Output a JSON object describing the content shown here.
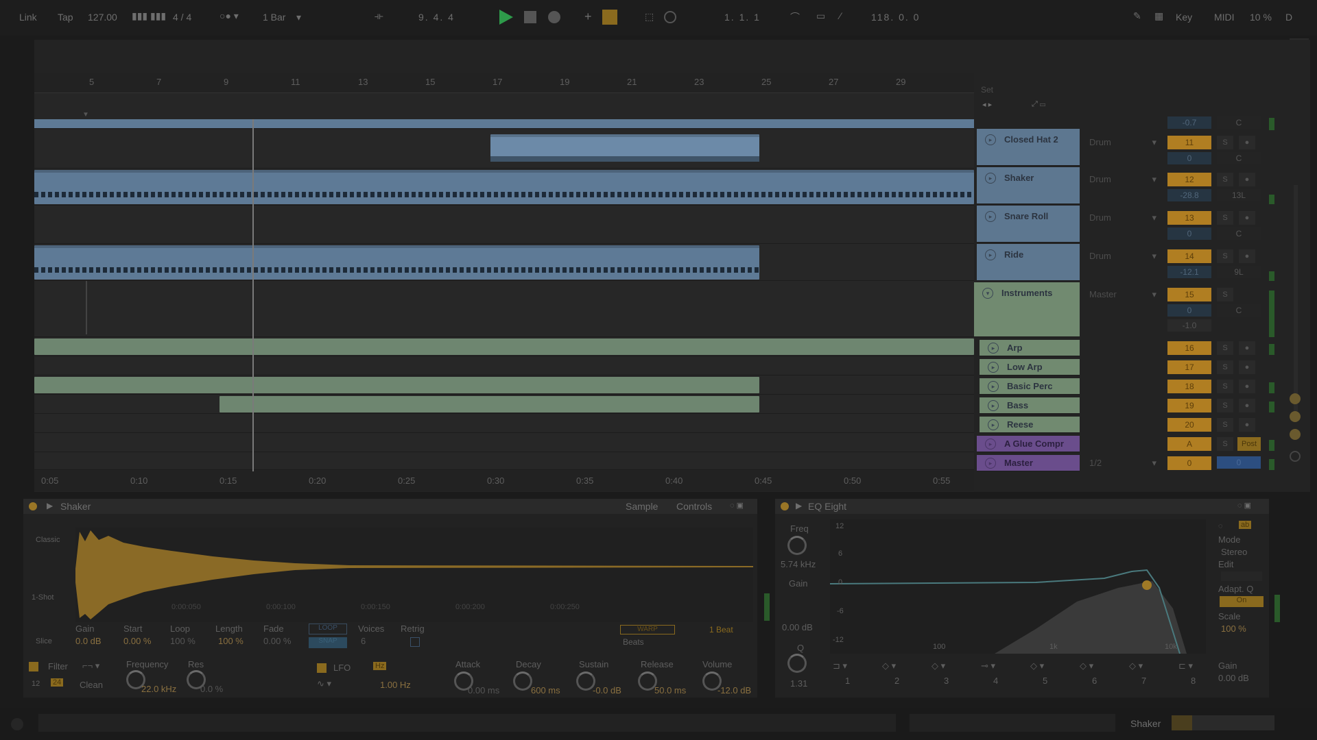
{
  "transport": {
    "link": "Link",
    "tap": "Tap",
    "tempo": "127.00",
    "signature": "4 / 4",
    "quantize": "1 Bar",
    "position": "9.   4.   4",
    "loop_start": "1.   1.   1",
    "loop_length": "118.   0.   0",
    "key": "Key",
    "midi": "MIDI",
    "cpu": "10 %",
    "d": "D"
  },
  "ruler": {
    "bars": [
      "5",
      "7",
      "9",
      "11",
      "13",
      "15",
      "17",
      "19",
      "21",
      "23",
      "25",
      "27",
      "29"
    ],
    "times": [
      "0:05",
      "0:10",
      "0:15",
      "0:20",
      "0:25",
      "0:30",
      "0:35",
      "0:40",
      "0:45",
      "0:50",
      "0:55"
    ]
  },
  "set_label": "Set",
  "tracks": [
    {
      "name": "Closed Hat 2",
      "route": "Drum",
      "num": "11",
      "vol": "0",
      "pan": "C",
      "color": "blue"
    },
    {
      "name": "Shaker",
      "route": "Drum",
      "num": "12",
      "vol": "-28.8",
      "pan": "13L",
      "color": "blue"
    },
    {
      "name": "Snare Roll",
      "route": "Drum",
      "num": "13",
      "vol": "0",
      "pan": "C",
      "color": "blue"
    },
    {
      "name": "Ride",
      "route": "Drum",
      "num": "14",
      "vol": "-12.1",
      "pan": "9L",
      "color": "blue"
    },
    {
      "name": "Instruments",
      "route": "Master",
      "num": "15",
      "vol": "0",
      "pan": "C",
      "extra": "-1.0",
      "color": "green"
    },
    {
      "name": "Arp",
      "num": "16",
      "color": "green"
    },
    {
      "name": "Low Arp",
      "num": "17",
      "color": "green"
    },
    {
      "name": "Basic Perc",
      "num": "18",
      "color": "green"
    },
    {
      "name": "Bass",
      "num": "19",
      "color": "green"
    },
    {
      "name": "Reese",
      "num": "20",
      "color": "green"
    },
    {
      "name": "A Glue Compr",
      "num": "A",
      "extra": "Post",
      "color": "purple"
    },
    {
      "name": "Master",
      "route": "1/2",
      "num": "0",
      "vol": "0",
      "color": "purple"
    }
  ],
  "top_values": {
    "vol": "-0.7",
    "pan": "C"
  },
  "sampler": {
    "title": "Shaker",
    "tab_sample": "Sample",
    "tab_controls": "Controls",
    "mode": "Classic",
    "one_shot": "1-Shot",
    "slice": "Slice",
    "ticks": [
      "0:00:050",
      "0:00:100",
      "0:00:150",
      "0:00:200",
      "0:00:250"
    ],
    "gain_lbl": "Gain",
    "gain": "0.0 dB",
    "start_lbl": "Start",
    "start": "0.00 %",
    "loop_lbl": "Loop",
    "loop": "100 %",
    "length_lbl": "Length",
    "length": "100 %",
    "fade_lbl": "Fade",
    "fade": "0.00 %",
    "loop_btn": "LOOP",
    "snap_btn": "SNAP",
    "voices_lbl": "Voices",
    "voices": "6",
    "retrig_lbl": "Retrig",
    "warp_btn": "WARP",
    "beats_lbl": "Beats",
    "beat_val": "1 Beat",
    "filter_lbl": "Filter",
    "filter_type": "Clean",
    "f12": "12",
    "f24": "24",
    "freq_lbl": "Frequency",
    "freq": "22.0 kHz",
    "res_lbl": "Res",
    "res": "0.0 %",
    "lfo_lbl": "LFO",
    "lfo_hz": "Hz",
    "lfo_rate": "1.00 Hz",
    "attack_lbl": "Attack",
    "attack": "0.00 ms",
    "decay_lbl": "Decay",
    "decay": "600 ms",
    "sustain_lbl": "Sustain",
    "sustain": "-0.0 dB",
    "release_lbl": "Release",
    "release": "50.0 ms",
    "volume_lbl": "Volume",
    "volume": "-12.0 dB"
  },
  "eq": {
    "title": "EQ Eight",
    "freq_lbl": "Freq",
    "freq": "5.74 kHz",
    "gain_lbl": "Gain",
    "gain": "0.00 dB",
    "q_lbl": "Q",
    "q": "1.31",
    "db_ticks": [
      "12",
      "6",
      "0",
      "-6",
      "-12"
    ],
    "hz_ticks": [
      "100",
      "1k",
      "10k"
    ],
    "mode_lbl": "Mode",
    "mode": "Stereo",
    "edit_lbl": "Edit",
    "adapt_lbl": "Adapt. Q",
    "adapt": "On",
    "scale_lbl": "Scale",
    "scale": "100 %",
    "out_gain_lbl": "Gain",
    "out_gain": "0.00 dB",
    "bands": [
      "1",
      "2",
      "3",
      "4",
      "5",
      "6",
      "7",
      "8"
    ],
    "ab": "ab"
  },
  "status": {
    "shaker": "Shaker"
  },
  "colors": {
    "accent": "#b07e22",
    "clip_blue": "#5e7a96",
    "clip_green": "#6e8670",
    "group_purple": "#6a4d8c",
    "play": "#2e9a4a"
  }
}
